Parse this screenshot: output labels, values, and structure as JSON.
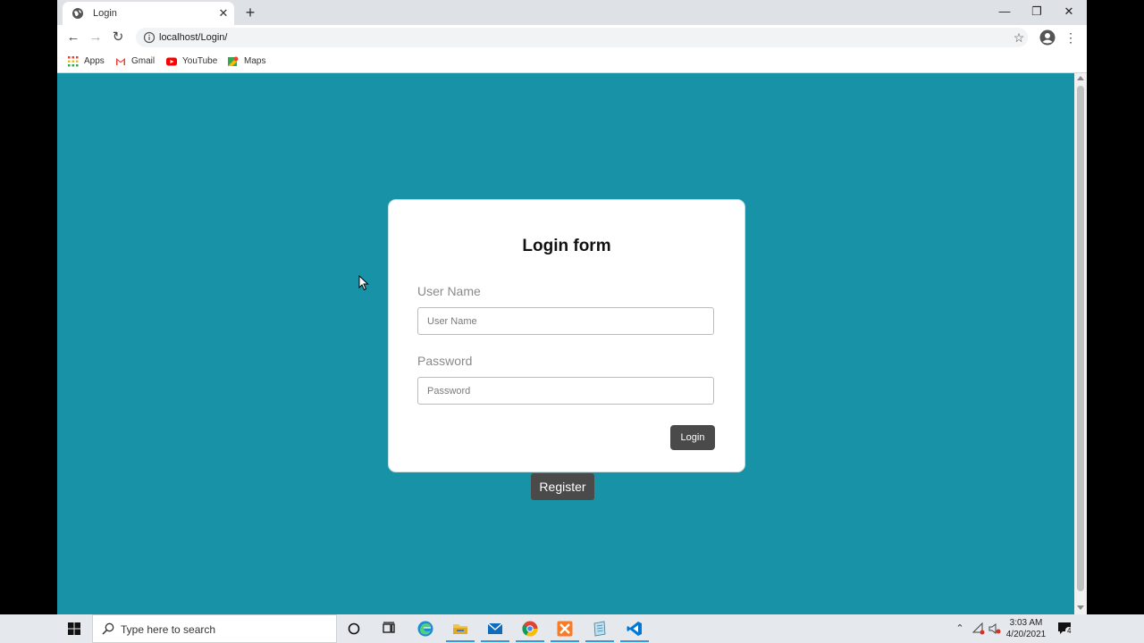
{
  "browser": {
    "tab_title": "Login",
    "tab_close": "✕",
    "new_tab": "+",
    "url": "localhost/Login/",
    "window_minimize": "—",
    "window_restore": "❐",
    "window_close": "✕",
    "bookmarks": [
      {
        "label": "Apps",
        "icon": "apps-grid-icon"
      },
      {
        "label": "Gmail",
        "icon": "gmail-icon"
      },
      {
        "label": "YouTube",
        "icon": "youtube-icon"
      },
      {
        "label": "Maps",
        "icon": "maps-icon"
      }
    ]
  },
  "page": {
    "background": "#1792a6",
    "form_title": "Login form",
    "username_label": "User Name",
    "username_placeholder": "User Name",
    "password_label": "Password",
    "password_placeholder": "Password",
    "login_button": "Login",
    "register_button": "Register"
  },
  "taskbar": {
    "search_placeholder": "Type here to search",
    "time": "3:03 AM",
    "date": "4/20/2021",
    "notification_count": "4",
    "pinned_apps": [
      "cortana-icon",
      "task-view-icon",
      "edge-icon",
      "file-explorer-icon",
      "mail-icon",
      "chrome-icon",
      "xampp-icon",
      "notepad-icon",
      "vscode-icon"
    ]
  }
}
